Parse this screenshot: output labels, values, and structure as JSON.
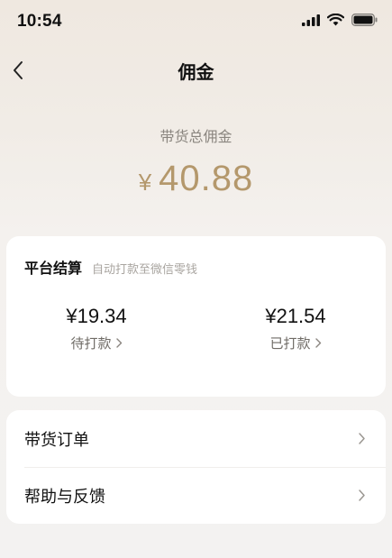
{
  "status_bar": {
    "time": "10:54"
  },
  "nav": {
    "title": "佣金"
  },
  "summary": {
    "label": "带货总佣金",
    "currency": "¥",
    "amount": "40.88"
  },
  "settlement": {
    "title": "平台结算",
    "subtitle": "自动打款至微信零钱",
    "pending": {
      "amount": "¥19.34",
      "label": "待打款"
    },
    "paid": {
      "amount": "¥21.54",
      "label": "已打款"
    }
  },
  "menu": [
    {
      "label": "带货订单"
    },
    {
      "label": "帮助与反馈"
    }
  ],
  "colors": {
    "accent": "#b4986c",
    "card": "#ffffff"
  }
}
